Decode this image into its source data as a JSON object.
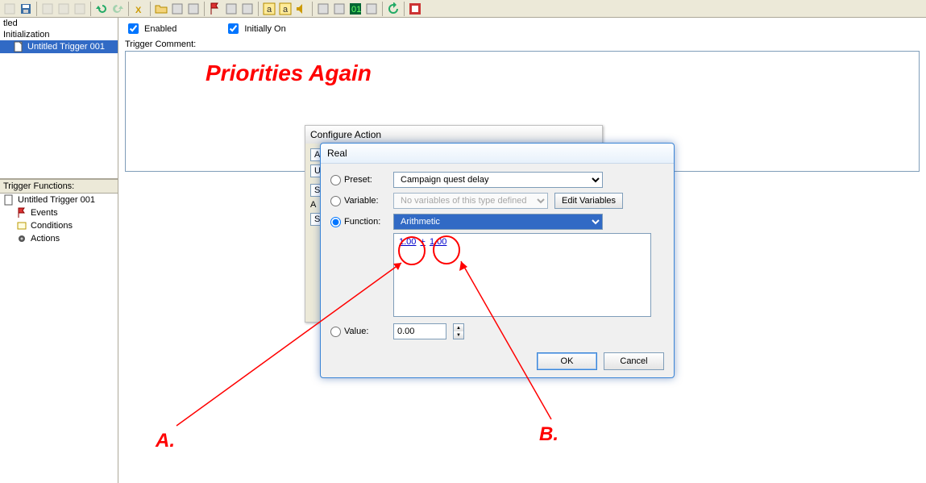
{
  "toolbar": {
    "items": [
      {
        "name": "new-icon",
        "disabled": true
      },
      {
        "name": "save-icon",
        "disabled": false
      },
      {
        "sep": true
      },
      {
        "name": "cut-icon",
        "disabled": true
      },
      {
        "name": "copy-icon",
        "disabled": true
      },
      {
        "name": "paste-icon",
        "disabled": true
      },
      {
        "sep": true
      },
      {
        "name": "undo-icon",
        "disabled": false
      },
      {
        "name": "redo-icon",
        "disabled": true
      },
      {
        "sep": true
      },
      {
        "name": "bold-x-icon",
        "disabled": false
      },
      {
        "sep": true
      },
      {
        "name": "folder-icon",
        "disabled": false
      },
      {
        "name": "new-trigger-icon",
        "disabled": false
      },
      {
        "name": "new-comment-icon",
        "disabled": false
      },
      {
        "sep": true
      },
      {
        "name": "flag-icon",
        "disabled": false
      },
      {
        "name": "event-list-icon",
        "disabled": false
      },
      {
        "name": "action-list-icon",
        "disabled": false
      },
      {
        "sep": true
      },
      {
        "name": "test-map-icon",
        "letter": "a",
        "disabled": false
      },
      {
        "name": "highlight-a-icon",
        "letter": "a",
        "disabled": false
      },
      {
        "name": "sound-icon",
        "disabled": false
      },
      {
        "sep": true
      },
      {
        "name": "owl-icon",
        "disabled": false
      },
      {
        "name": "camera-icon",
        "disabled": false
      },
      {
        "name": "matrix-icon",
        "disabled": false
      },
      {
        "name": "box-icon",
        "disabled": false
      },
      {
        "sep": true
      },
      {
        "name": "refresh-icon",
        "disabled": false
      },
      {
        "sep": true
      },
      {
        "name": "exit-icon",
        "disabled": false
      }
    ]
  },
  "left_tree_top": {
    "root": "tled",
    "child1": "Initialization",
    "leaf": "Untitled Trigger 001"
  },
  "left_section_label": "Trigger Functions:",
  "left_tree_bottom": {
    "root": "Untitled Trigger 001",
    "nodes": [
      "Events",
      "Conditions",
      "Actions"
    ]
  },
  "right_header": {
    "enabled_label": "Enabled",
    "initially_on_label": "Initially On",
    "comment_label": "Trigger Comment:"
  },
  "dlg_config": {
    "title": "Configure Action"
  },
  "dlg_real": {
    "title": "Real",
    "preset_label": "Preset:",
    "preset_value": "Campaign quest delay",
    "variable_label": "Variable:",
    "variable_value": "No variables of this type defined",
    "edit_variables_btn": "Edit Variables",
    "function_label": "Function:",
    "function_value": "Arithmetic",
    "expr_a": "1.00",
    "expr_op": "+",
    "expr_b": "1.00",
    "value_label": "Value:",
    "value_value": "0.00",
    "ok_btn": "OK",
    "cancel_btn": "Cancel"
  },
  "annotations": {
    "title": "Priorities Again",
    "label_a": "A.",
    "label_b": "B."
  }
}
